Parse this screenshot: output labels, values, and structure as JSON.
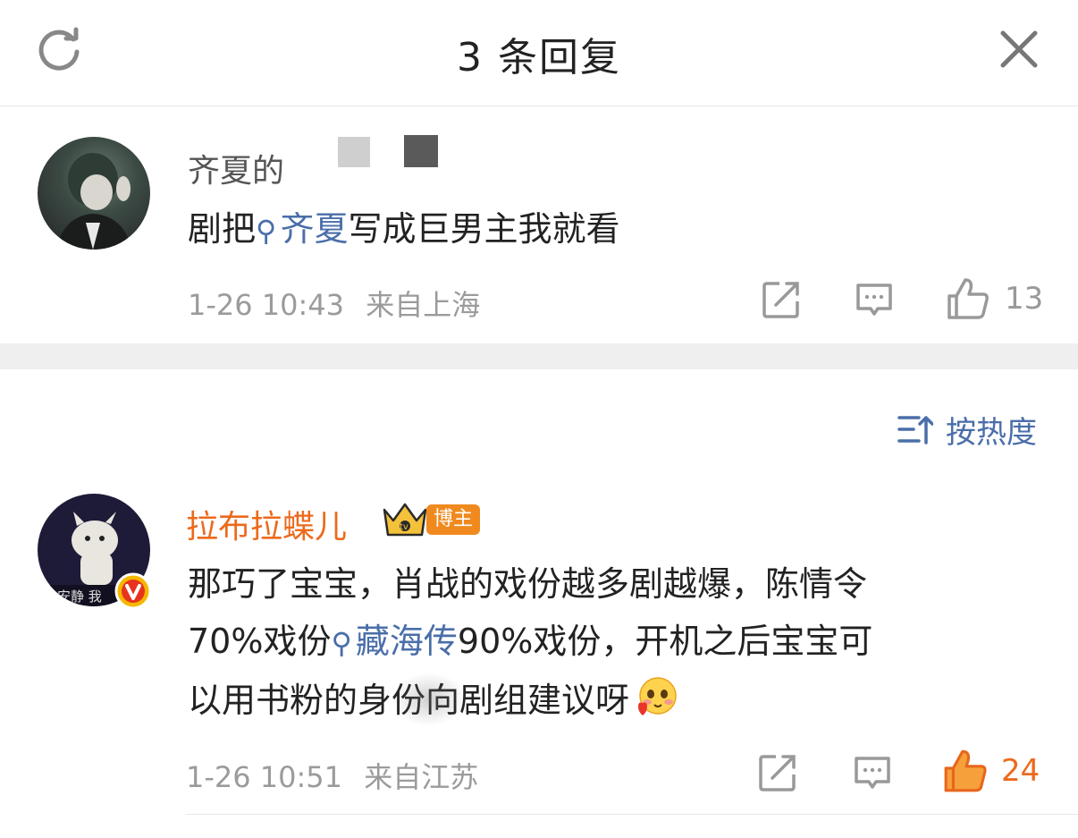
{
  "header": {
    "title": "3 条回复"
  },
  "comment1": {
    "username": "齐夏的",
    "text_before": "剧把",
    "tag": "齐夏",
    "text_after": "写成巨男主我就看",
    "time": "1-26 10:43",
    "location": "来自上海",
    "likes": "13"
  },
  "sort": {
    "label": "按热度"
  },
  "reply": {
    "username": "拉布拉蝶儿",
    "badge_label": "博主",
    "avatar_caption": "安静 我",
    "text_line1": "那巧了宝宝，肖战的戏份越多剧越爆，陈情令",
    "text_line2_before": "70%戏份",
    "tag": "藏海传",
    "text_line2_after": "90%戏份，开机之后宝宝可",
    "text_line3": "以用书粉的身份向剧组建议呀",
    "time": "1-26 10:51",
    "location": "来自江苏",
    "likes": "24"
  },
  "colors": {
    "accent_orange": "#ec6a1c",
    "link_blue": "#4a6ea9",
    "meta_gray": "#9b9b9b"
  },
  "icons": [
    "refresh-icon",
    "close-icon",
    "share-icon",
    "comment-icon",
    "like-icon",
    "sort-icon",
    "verified-icon",
    "crown-badge-icon",
    "blush-emoji"
  ]
}
